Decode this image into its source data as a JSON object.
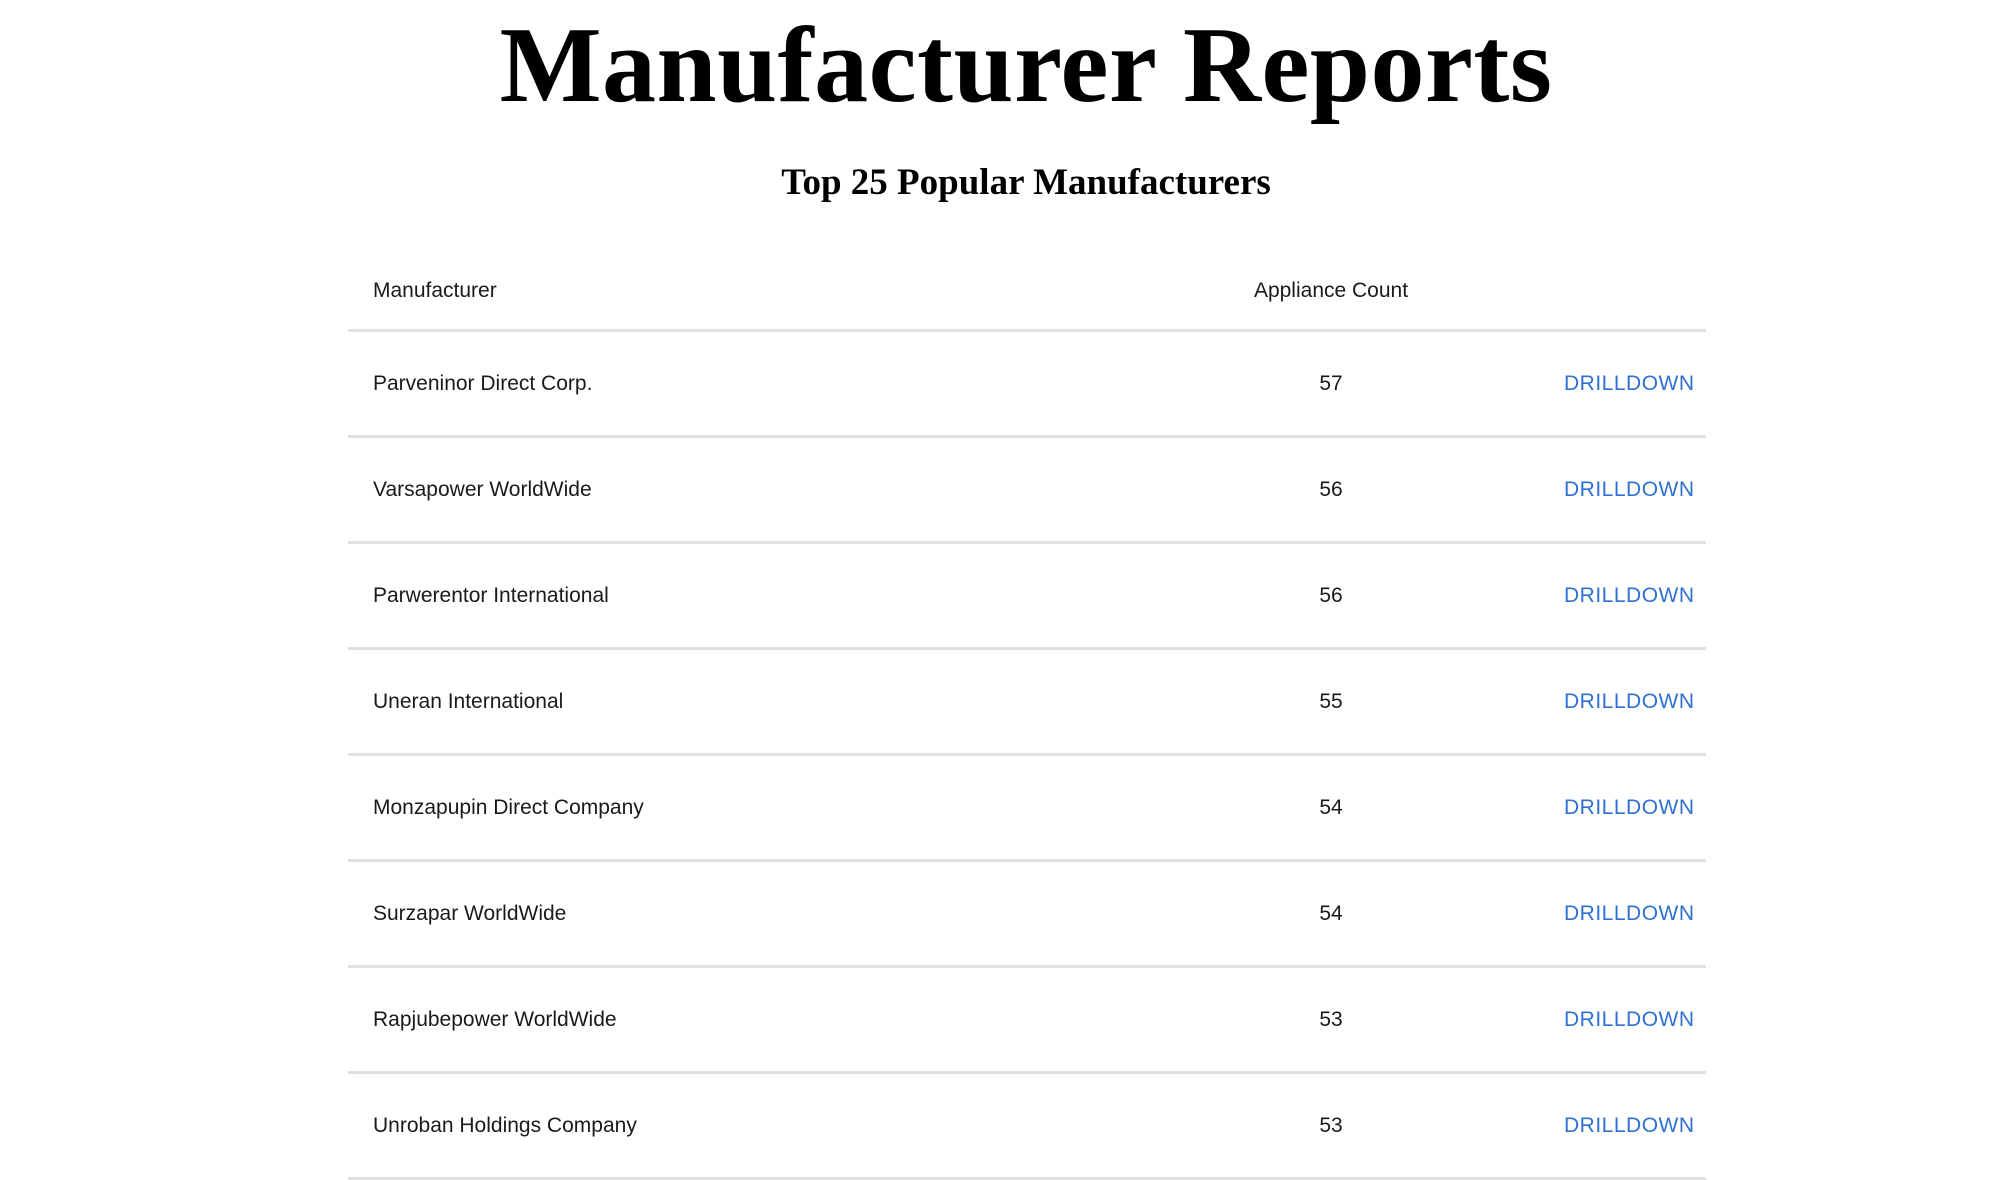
{
  "page": {
    "title": "Manufacturer Reports",
    "subtitle": "Top 25 Popular Manufacturers"
  },
  "table": {
    "headers": {
      "manufacturer": "Manufacturer",
      "count": "Appliance Count",
      "action": ""
    },
    "rows": [
      {
        "manufacturer": "Parveninor Direct Corp.",
        "count": "57",
        "action": "DRILLDOWN"
      },
      {
        "manufacturer": "Varsapower WorldWide",
        "count": "56",
        "action": "DRILLDOWN"
      },
      {
        "manufacturer": "Parwerentor International",
        "count": "56",
        "action": "DRILLDOWN"
      },
      {
        "manufacturer": "Uneran International",
        "count": "55",
        "action": "DRILLDOWN"
      },
      {
        "manufacturer": "Monzapupin Direct Company",
        "count": "54",
        "action": "DRILLDOWN"
      },
      {
        "manufacturer": "Surzapar WorldWide",
        "count": "54",
        "action": "DRILLDOWN"
      },
      {
        "manufacturer": "Rapjubepower WorldWide",
        "count": "53",
        "action": "DRILLDOWN"
      },
      {
        "manufacturer": "Unroban Holdings Company",
        "count": "53",
        "action": "DRILLDOWN"
      }
    ]
  },
  "colors": {
    "link": "#2f71d2",
    "divider": "#e0e0e0",
    "text": "#1a1a1a"
  }
}
